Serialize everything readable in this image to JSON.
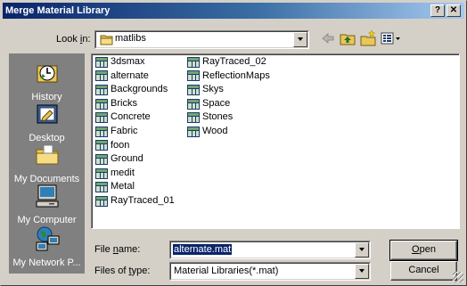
{
  "window": {
    "title": "Merge Material Library",
    "help_glyph": "?",
    "close_glyph": "✕"
  },
  "lookin": {
    "label_pre": "Look ",
    "label_key": "i",
    "label_post": "n:",
    "value": "matlibs"
  },
  "places": [
    {
      "label": "History",
      "icon": "history-icon"
    },
    {
      "label": "Desktop",
      "icon": "desktop-icon"
    },
    {
      "label": "My Documents",
      "icon": "my-documents-icon"
    },
    {
      "label": "My Computer",
      "icon": "my-computer-icon"
    },
    {
      "label": "My Network P...",
      "icon": "my-network-places-icon"
    }
  ],
  "files": {
    "col1": [
      "3dsmax",
      "alternate",
      "Backgrounds",
      "Bricks",
      "Concrete",
      "Fabric",
      "foon",
      "Ground",
      "medit",
      "Metal",
      "RayTraced_01"
    ],
    "col2": [
      "RayTraced_02",
      "ReflectionMaps",
      "Skys",
      "Space",
      "Stones",
      "Wood"
    ]
  },
  "filename": {
    "label_pre": "File ",
    "label_key": "n",
    "label_post": "ame:",
    "value": "alternate.mat"
  },
  "filetype": {
    "label_pre": "Files of ",
    "label_key": "t",
    "label_post": "ype:",
    "value": "Material Libraries(*.mat)"
  },
  "buttons": {
    "open_key": "O",
    "open_rest": "pen",
    "cancel": "Cancel"
  },
  "colors": {
    "title_active": "#0a246a",
    "dialog_face": "#d4d0c8",
    "places_bar": "#808080",
    "selection": "#0a246a"
  }
}
